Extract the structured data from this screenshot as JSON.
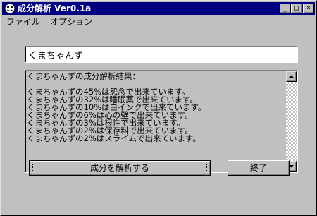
{
  "window": {
    "title": "成分解析  Ver0.1a",
    "controls": {
      "minimize": "_",
      "maximize": "□",
      "close": "×"
    }
  },
  "menu": {
    "items": [
      "ファイル",
      "オプション"
    ]
  },
  "input": {
    "value": "くまちゃんず"
  },
  "result": {
    "lines": [
      "くまちゃんずの成分解析結果：",
      "",
      "くまちゃんずの45%は怨念で出来ています。",
      "くまちゃんずの32%は睡眠薬で出来ています。",
      "くまちゃんずの10%は白インクで出来ています。",
      "くまちゃんずの6%は心の壁で出来ています。",
      "くまちゃんずの3%は根性で出来ています。",
      "くまちゃんずの2%は保存料で出来ています。",
      "くまちゃんずの2%はスライムで出来ています。"
    ]
  },
  "buttons": {
    "analyze": "成分を解析する",
    "exit": "終了"
  },
  "icons": {
    "app": "app-icon",
    "scroll_up": "scroll-up-icon",
    "scroll_down": "scroll-down-icon"
  },
  "colors": {
    "titlebar": "#000080",
    "face": "#c0c0c0"
  }
}
